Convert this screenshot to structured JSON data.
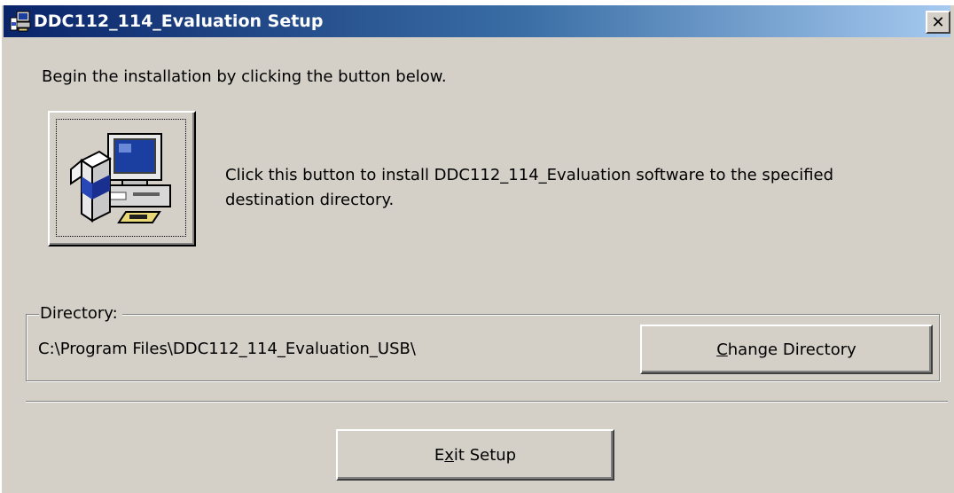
{
  "window": {
    "title": "DDC112_114_Evaluation Setup",
    "title_icon": "setup-computer-icon",
    "close_label": "✕"
  },
  "intro_text": "Begin the installation by clicking the button below.",
  "install": {
    "icon": "computer-install-icon",
    "description": "Click this button to install DDC112_114_Evaluation software to the specified destination directory."
  },
  "directory": {
    "legend": "Directory:",
    "path": "C:\\Program Files\\DDC112_114_Evaluation_USB\\",
    "change_button": {
      "mnemonic": "C",
      "rest": "hange Directory"
    }
  },
  "exit_button": {
    "before": "E",
    "mnemonic": "x",
    "after": "it Setup"
  },
  "colors": {
    "dialog_face": "#d4d0c8",
    "title_gradient_start": "#0a246a",
    "title_gradient_end": "#a6caf0"
  }
}
